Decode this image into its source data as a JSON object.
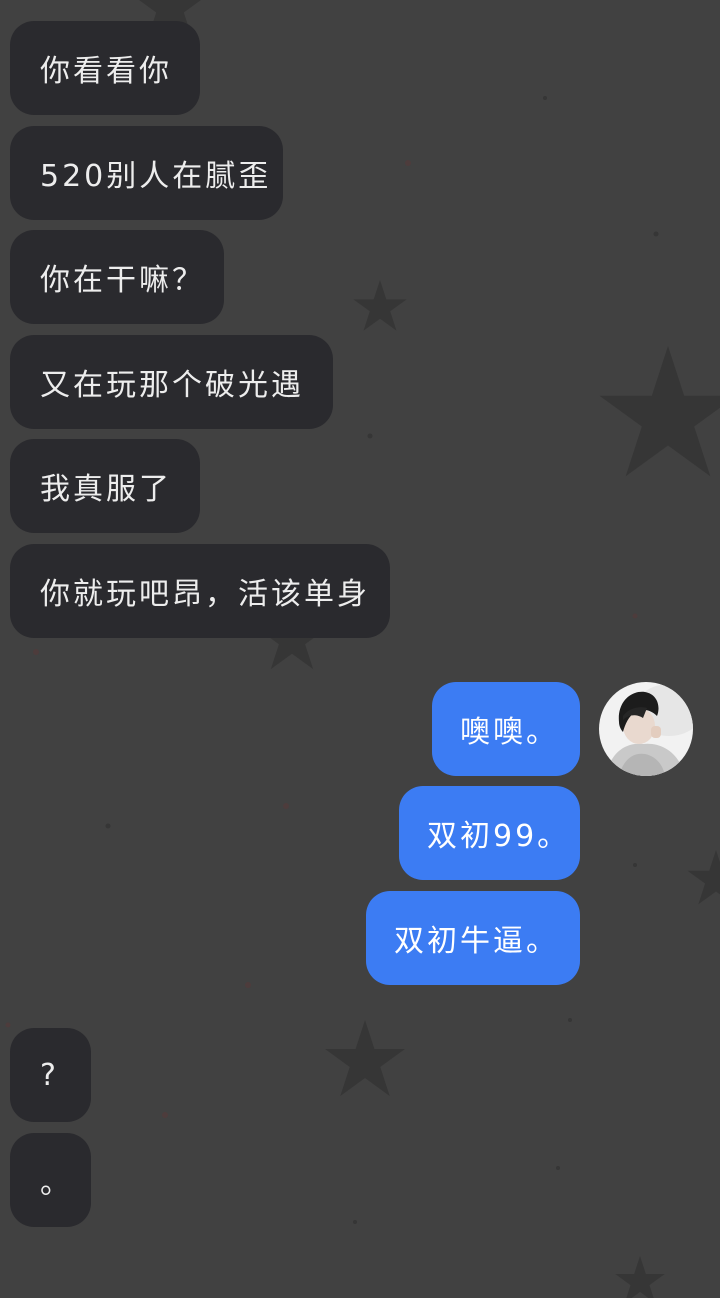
{
  "conversation": {
    "incoming_top": [
      "你看看你",
      "520别人在腻歪",
      "你在干嘛？",
      "又在玩那个破光遇",
      "我真服了",
      "你就玩吧昂，活该单身"
    ],
    "outgoing": [
      "噢噢。",
      "双初99。",
      "双初牛逼。"
    ],
    "incoming_bottom": [
      "?",
      "。"
    ]
  },
  "colors": {
    "background": "#414141",
    "incoming_bubble": "#2a2a2e",
    "outgoing_bubble": "#3c7cf3",
    "star": "#363636"
  }
}
